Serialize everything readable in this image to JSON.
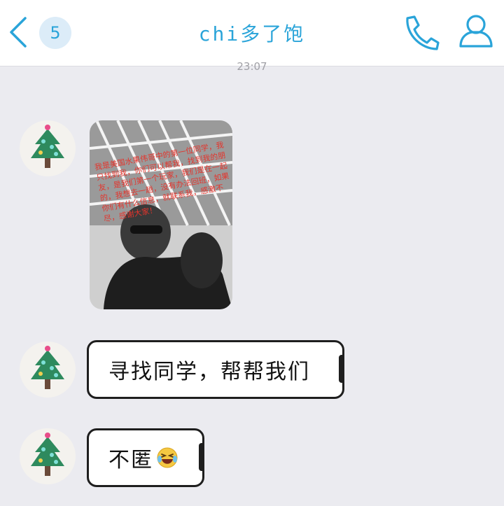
{
  "header": {
    "unread_count": "5",
    "title": "chi多了饱"
  },
  "timestamp": "23:07",
  "messages": [
    {
      "type": "image",
      "caption": "我是美国水果伟哥中的第一位同学，我只找到我，你们可以帮我，找到我的朋友，是我们第一个玩家，我们是在一起的，我想去一趟，没有办法回班，如果你们有什么信息，就联系我，感激不尽，感谢大家！"
    },
    {
      "type": "text",
      "text": "寻找同学，帮帮我们"
    },
    {
      "type": "text",
      "text": "不匿"
    }
  ],
  "colors": {
    "accent": "#2aa4d9",
    "background": "#ebebf0",
    "caption_red": "#e4342c"
  },
  "icons": [
    "back-chevron-icon",
    "phone-icon",
    "profile-icon",
    "laughing-crying-emoji-icon"
  ]
}
